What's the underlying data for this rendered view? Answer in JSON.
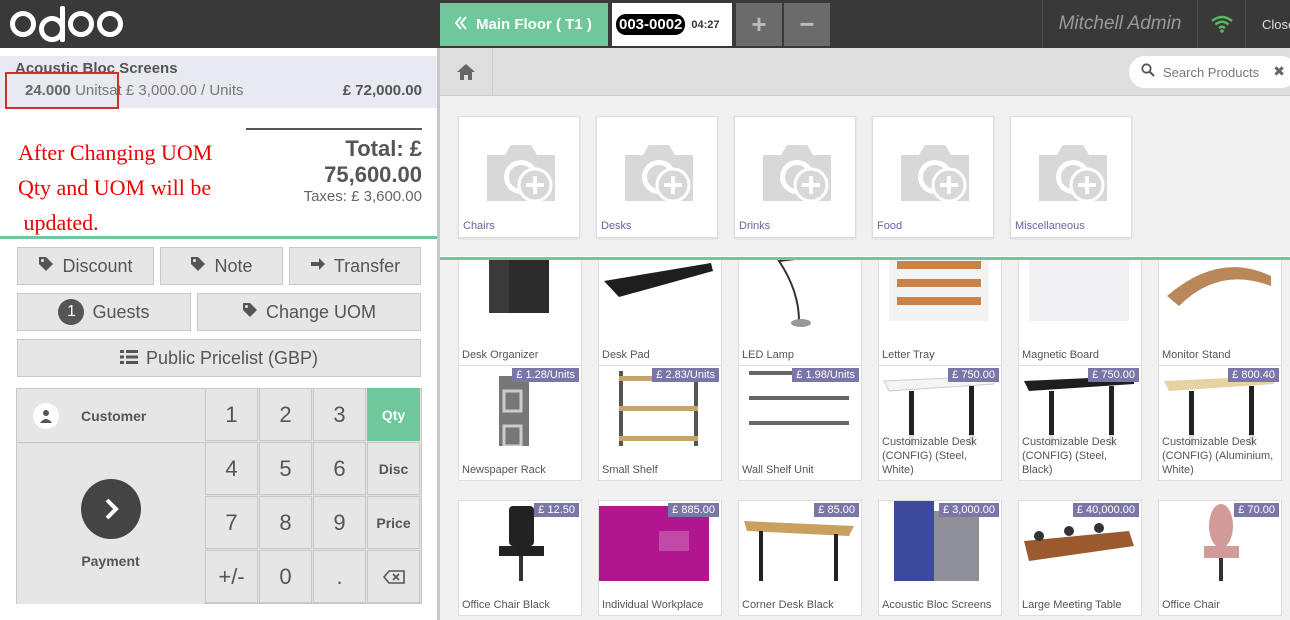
{
  "topbar": {
    "logo_text": "odoo",
    "floor_button": "Main Floor ( T1 )",
    "order_number": "003-0002",
    "order_time": "04:27",
    "add_symbol": "+",
    "remove_symbol": "−",
    "user_name": "Mitchell Admin",
    "close_label": "Close"
  },
  "order": {
    "line": {
      "product": "Acoustic Bloc Screens",
      "qty": "24.000",
      "uom": "Units",
      "unit_price_text": "at £ 3,000.00 / Units",
      "line_total": "£ 72,000.00"
    },
    "total": "Total: £ 75,600.00",
    "taxes": "Taxes: £ 3,600.00"
  },
  "annotation": {
    "line1": "After Changing UOM",
    "line2": "Qty and UOM will be",
    "line3": " updated."
  },
  "controls": {
    "discount": "Discount",
    "note": "Note",
    "transfer": "Transfer",
    "guests_count": "1",
    "guests": "Guests",
    "change_uom": "Change UOM",
    "pricelist": "Public Pricelist (GBP)"
  },
  "numpad": {
    "customer": "Customer",
    "payment": "Payment",
    "keys": [
      "1",
      "2",
      "3",
      "4",
      "5",
      "6",
      "7",
      "8",
      "9",
      "+/-",
      "0",
      "."
    ],
    "modes": [
      "Qty",
      "Disc",
      "Price"
    ],
    "active_mode": "Qty"
  },
  "search": {
    "placeholder": "Search Products"
  },
  "categories": [
    "Chairs",
    "Desks",
    "Drinks",
    "Food",
    "Miscellaneous"
  ],
  "products": [
    {
      "name": "Desk Organizer",
      "price": ""
    },
    {
      "name": "Desk Pad",
      "price": ""
    },
    {
      "name": "LED Lamp",
      "price": ""
    },
    {
      "name": "Letter Tray",
      "price": ""
    },
    {
      "name": "Magnetic Board",
      "price": ""
    },
    {
      "name": "Monitor Stand",
      "price": ""
    },
    {
      "name": "Newspaper Rack",
      "price": "£ 1.28/Units"
    },
    {
      "name": "Small Shelf",
      "price": "£ 2.83/Units"
    },
    {
      "name": "Wall Shelf Unit",
      "price": "£ 1.98/Units"
    },
    {
      "name": "Customizable Desk (CONFIG) (Steel, White)",
      "price": "£ 750.00"
    },
    {
      "name": "Customizable Desk (CONFIG) (Steel, Black)",
      "price": "£ 750.00"
    },
    {
      "name": "Customizable Desk (CONFIG) (Aluminium, White)",
      "price": "£ 800.40"
    },
    {
      "name": "Office Chair Black",
      "price": "£ 12.50"
    },
    {
      "name": "Individual Workplace",
      "price": "£ 885.00"
    },
    {
      "name": "Corner Desk Black",
      "price": "£ 85.00"
    },
    {
      "name": "Acoustic Bloc Screens",
      "price": "£ 3,000.00"
    },
    {
      "name": "Large Meeting Table",
      "price": "£ 40,000.00"
    },
    {
      "name": "Office Chair",
      "price": "£ 70.00"
    }
  ],
  "colors": {
    "accent_green": "#6ec89b",
    "topbar": "#393939",
    "annotation_red": "#e00000",
    "price_tag": "#7a77a8"
  }
}
